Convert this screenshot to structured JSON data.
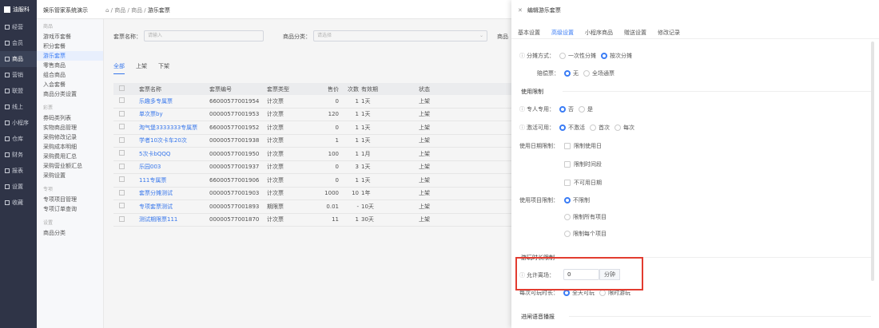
{
  "app": {
    "logo": "油服科",
    "system_title": "娱乐管家系统演示"
  },
  "breadcrumb": [
    "商品",
    "游乐套票"
  ],
  "nav_primary": [
    {
      "label": "经营"
    },
    {
      "label": "会员"
    },
    {
      "label": "商品"
    },
    {
      "label": "营销"
    },
    {
      "label": "联盟"
    },
    {
      "label": "线上"
    },
    {
      "label": "小程序"
    },
    {
      "label": "仓库"
    },
    {
      "label": "财务"
    },
    {
      "label": "报表"
    },
    {
      "label": "设置"
    },
    {
      "label": "收藏"
    }
  ],
  "nav_secondary": {
    "groups": [
      {
        "title": "商品",
        "items": [
          "游戏币套餐",
          "积分套餐",
          "游乐套票",
          "零售商品",
          "组合商品",
          "入会套餐",
          "商品分类设置"
        ]
      },
      {
        "title": "彩票",
        "items": [
          "券码类列表",
          "实物商品管理",
          "采购修改记录",
          "采购成本明细",
          "采购费用汇总",
          "采购营业额汇总",
          "采购设置"
        ]
      },
      {
        "title": "专项",
        "items": [
          "专项项目管理",
          "专项订单查询"
        ]
      },
      {
        "title": "设置",
        "items": [
          "商品分类"
        ]
      }
    ]
  },
  "filters": {
    "name_label": "套票名称：",
    "name_placeholder": "请输入",
    "category_label": "商品分类：",
    "category_placeholder": "请选择",
    "more_label": "商品"
  },
  "tabs": [
    "全部",
    "上架",
    "下架"
  ],
  "table": {
    "headers": [
      "套票名称",
      "套票编号",
      "套票类型",
      "售价",
      "次数",
      "有效期",
      "状态"
    ],
    "rows": [
      {
        "name": "乐趣多专属票",
        "code": "66000577001954",
        "type": "计次票",
        "price": "0",
        "times": "1",
        "valid": "1天",
        "status": "上架"
      },
      {
        "name": "单次票by",
        "code": "00000577001953",
        "type": "计次票",
        "price": "120",
        "times": "1",
        "valid": "1天",
        "status": "上架"
      },
      {
        "name": "淘气堡3333333专属票",
        "code": "66000577001952",
        "type": "计次票",
        "price": "0",
        "times": "1",
        "valid": "1天",
        "status": "上架"
      },
      {
        "name": "学者10次卡车20次",
        "code": "00000577001938",
        "type": "计次票",
        "price": "1",
        "times": "1",
        "valid": "1天",
        "status": "上架"
      },
      {
        "name": "5次卡bQQQ",
        "code": "00000577001950",
        "type": "计次票",
        "price": "100",
        "times": "1",
        "valid": "1月",
        "status": "上架"
      },
      {
        "name": "乐园003",
        "code": "00000577001937",
        "type": "计次票",
        "price": "0",
        "times": "3",
        "valid": "1天",
        "status": "上架"
      },
      {
        "name": "111专属票",
        "code": "66000577001906",
        "type": "计次票",
        "price": "0",
        "times": "1",
        "valid": "1天",
        "status": "上架"
      },
      {
        "name": "套票分摊测试",
        "code": "00000577001903",
        "type": "计次票",
        "price": "1000",
        "times": "10",
        "valid": "1年",
        "status": "上架"
      },
      {
        "name": "专项套票测试",
        "code": "00000577001893",
        "type": "期限票",
        "price": "0.01",
        "times": "-",
        "valid": "10天",
        "status": "上架"
      },
      {
        "name": "测试期限票111",
        "code": "00000577001870",
        "type": "计次票",
        "price": "11",
        "times": "1",
        "valid": "30天",
        "status": "上架"
      }
    ]
  },
  "panel": {
    "title": "编辑游乐套票",
    "tabs": [
      "基本设置",
      "高级设置",
      "小程序商品",
      "赠送设置",
      "修改记录"
    ],
    "split_label": "分摊方式：",
    "split_opts": [
      "一次性分摊",
      "按次分摊"
    ],
    "fixed_label": "赔偿票：",
    "fixed_opts": [
      "无",
      "全场通票"
    ],
    "sec_limit": "使用限制",
    "exclusive_label": "专人专用：",
    "exclusive_opts": [
      "否",
      "是"
    ],
    "unlock_label": "激活可用：",
    "unlock_opts": [
      "不激活",
      "首次",
      "每次"
    ],
    "date_label": "使用日期限制：",
    "date_opts": [
      "限制使用日",
      "限制时间段",
      "不可用日期"
    ],
    "proj_label": "使用项目限制：",
    "proj_opts": [
      "不限制",
      "限制所有项目",
      "限制每个项目"
    ],
    "sec_duration": "游玩时长限制",
    "allow_label": "允许离场：",
    "allow_value": "0",
    "allow_unit": "分钟",
    "each_label": "每次可玩时长：",
    "each_opts": [
      "全天可玩",
      "限时游玩"
    ],
    "sec_notice": "进闸语音播报"
  }
}
